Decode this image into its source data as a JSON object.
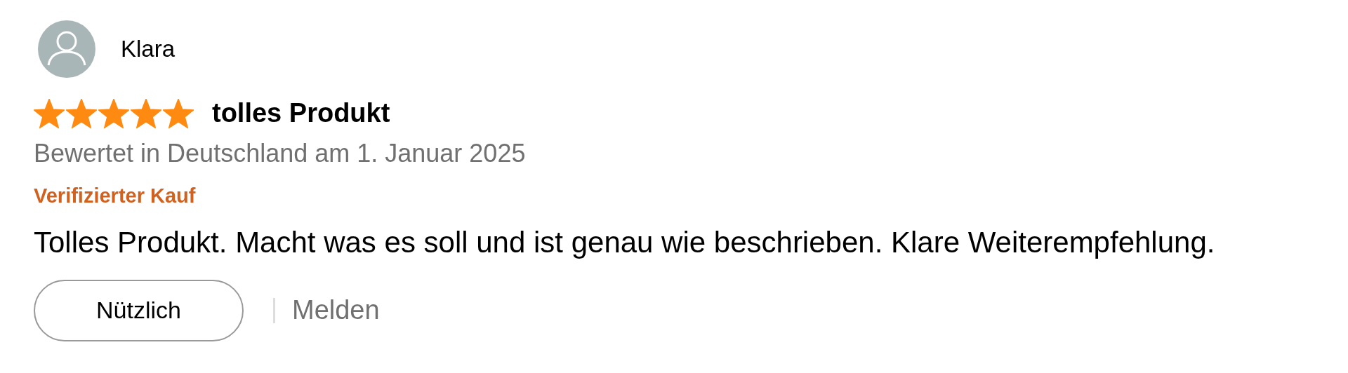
{
  "review": {
    "author": "Klara",
    "stars": 5,
    "title": "tolles Produkt",
    "meta": "Bewertet in Deutschland am 1. Januar 2025",
    "badge": "Verifizierter Kauf",
    "body": "Tolles Produkt. Macht was es soll und ist genau wie beschrieben. Klare Weiterempfehlung.",
    "helpful_button": "Nützlich",
    "report_link": "Melden"
  }
}
